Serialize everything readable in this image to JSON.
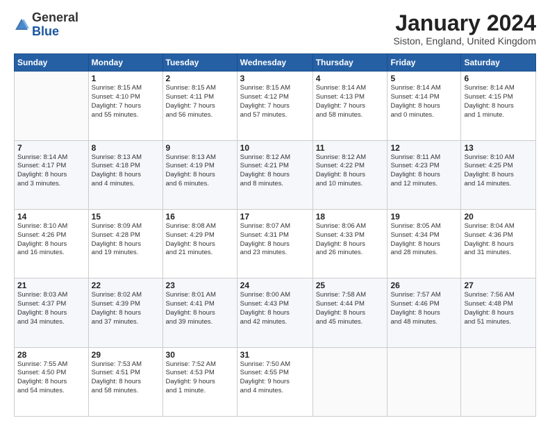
{
  "logo": {
    "general": "General",
    "blue": "Blue"
  },
  "title": "January 2024",
  "location": "Siston, England, United Kingdom",
  "days_header": [
    "Sunday",
    "Monday",
    "Tuesday",
    "Wednesday",
    "Thursday",
    "Friday",
    "Saturday"
  ],
  "weeks": [
    [
      {
        "num": "",
        "info": ""
      },
      {
        "num": "1",
        "info": "Sunrise: 8:15 AM\nSunset: 4:10 PM\nDaylight: 7 hours\nand 55 minutes."
      },
      {
        "num": "2",
        "info": "Sunrise: 8:15 AM\nSunset: 4:11 PM\nDaylight: 7 hours\nand 56 minutes."
      },
      {
        "num": "3",
        "info": "Sunrise: 8:15 AM\nSunset: 4:12 PM\nDaylight: 7 hours\nand 57 minutes."
      },
      {
        "num": "4",
        "info": "Sunrise: 8:14 AM\nSunset: 4:13 PM\nDaylight: 7 hours\nand 58 minutes."
      },
      {
        "num": "5",
        "info": "Sunrise: 8:14 AM\nSunset: 4:14 PM\nDaylight: 8 hours\nand 0 minutes."
      },
      {
        "num": "6",
        "info": "Sunrise: 8:14 AM\nSunset: 4:15 PM\nDaylight: 8 hours\nand 1 minute."
      }
    ],
    [
      {
        "num": "7",
        "info": "Sunrise: 8:14 AM\nSunset: 4:17 PM\nDaylight: 8 hours\nand 3 minutes."
      },
      {
        "num": "8",
        "info": "Sunrise: 8:13 AM\nSunset: 4:18 PM\nDaylight: 8 hours\nand 4 minutes."
      },
      {
        "num": "9",
        "info": "Sunrise: 8:13 AM\nSunset: 4:19 PM\nDaylight: 8 hours\nand 6 minutes."
      },
      {
        "num": "10",
        "info": "Sunrise: 8:12 AM\nSunset: 4:21 PM\nDaylight: 8 hours\nand 8 minutes."
      },
      {
        "num": "11",
        "info": "Sunrise: 8:12 AM\nSunset: 4:22 PM\nDaylight: 8 hours\nand 10 minutes."
      },
      {
        "num": "12",
        "info": "Sunrise: 8:11 AM\nSunset: 4:23 PM\nDaylight: 8 hours\nand 12 minutes."
      },
      {
        "num": "13",
        "info": "Sunrise: 8:10 AM\nSunset: 4:25 PM\nDaylight: 8 hours\nand 14 minutes."
      }
    ],
    [
      {
        "num": "14",
        "info": "Sunrise: 8:10 AM\nSunset: 4:26 PM\nDaylight: 8 hours\nand 16 minutes."
      },
      {
        "num": "15",
        "info": "Sunrise: 8:09 AM\nSunset: 4:28 PM\nDaylight: 8 hours\nand 19 minutes."
      },
      {
        "num": "16",
        "info": "Sunrise: 8:08 AM\nSunset: 4:29 PM\nDaylight: 8 hours\nand 21 minutes."
      },
      {
        "num": "17",
        "info": "Sunrise: 8:07 AM\nSunset: 4:31 PM\nDaylight: 8 hours\nand 23 minutes."
      },
      {
        "num": "18",
        "info": "Sunrise: 8:06 AM\nSunset: 4:33 PM\nDaylight: 8 hours\nand 26 minutes."
      },
      {
        "num": "19",
        "info": "Sunrise: 8:05 AM\nSunset: 4:34 PM\nDaylight: 8 hours\nand 28 minutes."
      },
      {
        "num": "20",
        "info": "Sunrise: 8:04 AM\nSunset: 4:36 PM\nDaylight: 8 hours\nand 31 minutes."
      }
    ],
    [
      {
        "num": "21",
        "info": "Sunrise: 8:03 AM\nSunset: 4:37 PM\nDaylight: 8 hours\nand 34 minutes."
      },
      {
        "num": "22",
        "info": "Sunrise: 8:02 AM\nSunset: 4:39 PM\nDaylight: 8 hours\nand 37 minutes."
      },
      {
        "num": "23",
        "info": "Sunrise: 8:01 AM\nSunset: 4:41 PM\nDaylight: 8 hours\nand 39 minutes."
      },
      {
        "num": "24",
        "info": "Sunrise: 8:00 AM\nSunset: 4:43 PM\nDaylight: 8 hours\nand 42 minutes."
      },
      {
        "num": "25",
        "info": "Sunrise: 7:58 AM\nSunset: 4:44 PM\nDaylight: 8 hours\nand 45 minutes."
      },
      {
        "num": "26",
        "info": "Sunrise: 7:57 AM\nSunset: 4:46 PM\nDaylight: 8 hours\nand 48 minutes."
      },
      {
        "num": "27",
        "info": "Sunrise: 7:56 AM\nSunset: 4:48 PM\nDaylight: 8 hours\nand 51 minutes."
      }
    ],
    [
      {
        "num": "28",
        "info": "Sunrise: 7:55 AM\nSunset: 4:50 PM\nDaylight: 8 hours\nand 54 minutes."
      },
      {
        "num": "29",
        "info": "Sunrise: 7:53 AM\nSunset: 4:51 PM\nDaylight: 8 hours\nand 58 minutes."
      },
      {
        "num": "30",
        "info": "Sunrise: 7:52 AM\nSunset: 4:53 PM\nDaylight: 9 hours\nand 1 minute."
      },
      {
        "num": "31",
        "info": "Sunrise: 7:50 AM\nSunset: 4:55 PM\nDaylight: 9 hours\nand 4 minutes."
      },
      {
        "num": "",
        "info": ""
      },
      {
        "num": "",
        "info": ""
      },
      {
        "num": "",
        "info": ""
      }
    ]
  ]
}
